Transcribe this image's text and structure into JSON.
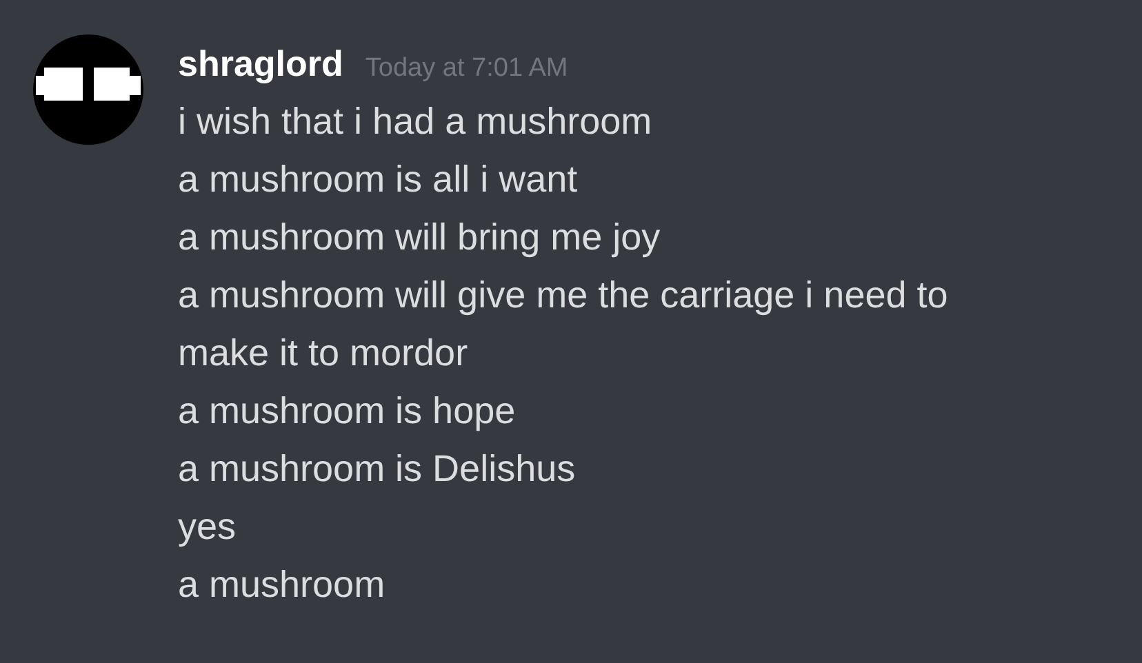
{
  "message": {
    "author": "shraglord",
    "timestamp": "Today at 7:01 AM",
    "lines": [
      "i wish that i had a mushroom",
      "a mushroom is all i want",
      "a mushroom will bring me joy",
      "a mushroom will give me the carriage i need to",
      "make it to mordor",
      "a mushroom is hope",
      "a mushroom is Delishus",
      "yes",
      "a mushroom"
    ]
  }
}
